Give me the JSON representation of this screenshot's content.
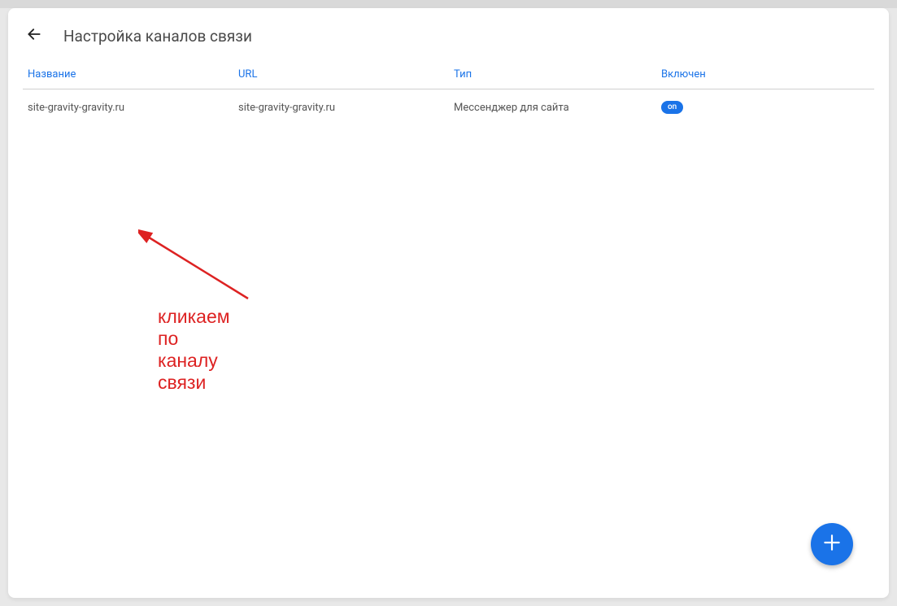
{
  "header": {
    "title": "Настройка каналов связи"
  },
  "table": {
    "columns": {
      "name": "Название",
      "url": "URL",
      "type": "Тип",
      "enabled": "Включен"
    },
    "rows": [
      {
        "name": "site-gravity-gravity.ru",
        "url": "site-gravity-gravity.ru",
        "type": "Мессенджер для сайта",
        "enabled_label": "on"
      }
    ]
  },
  "annotation": {
    "text": "кликаем по каналу связи"
  }
}
